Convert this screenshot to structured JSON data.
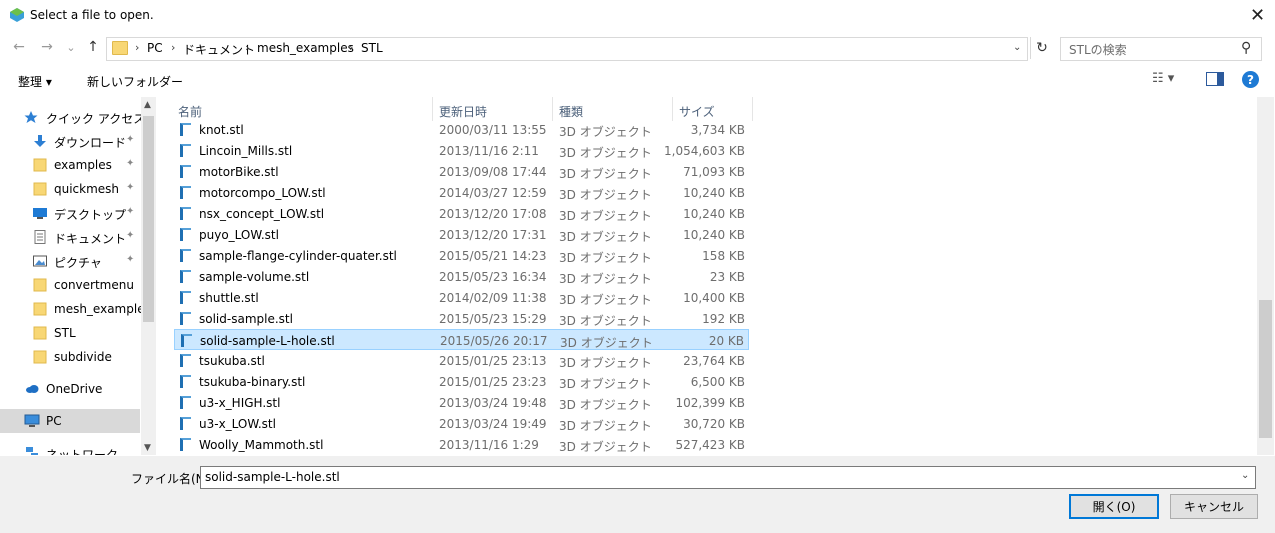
{
  "window": {
    "title": "Select a file to open.",
    "close": "✕"
  },
  "nav": {
    "back": "←",
    "forward": "→",
    "recent": "⌄",
    "up": "↑",
    "breadcrumbs": [
      "PC",
      "ドキュメント",
      "mesh_examples",
      "STL"
    ],
    "crumb_sep": "›",
    "search_placeholder": "STLの検索"
  },
  "toolbar": {
    "organize": "整理 ▾",
    "new_folder": "新しいフォルダー",
    "help": "?"
  },
  "sidebar": {
    "items": [
      {
        "label": "クイック アクセス",
        "icon": "star-icon",
        "pinned": false
      },
      {
        "label": "ダウンロード",
        "icon": "download-icon",
        "pinned": true
      },
      {
        "label": "examples",
        "icon": "folder-icon",
        "pinned": true
      },
      {
        "label": "quickmesh",
        "icon": "folder-icon",
        "pinned": true
      },
      {
        "label": "デスクトップ",
        "icon": "desktop-icon",
        "pinned": true
      },
      {
        "label": "ドキュメント",
        "icon": "document-icon",
        "pinned": true
      },
      {
        "label": "ピクチャ",
        "icon": "pictures-icon",
        "pinned": true
      },
      {
        "label": "convertmenu",
        "icon": "folder-icon",
        "pinned": false
      },
      {
        "label": "mesh_examples",
        "icon": "folder-icon",
        "pinned": false
      },
      {
        "label": "STL",
        "icon": "folder-icon",
        "pinned": false
      },
      {
        "label": "subdivide",
        "icon": "folder-icon",
        "pinned": false
      },
      {
        "label": "OneDrive",
        "icon": "cloud-icon",
        "pinned": false
      },
      {
        "label": "PC",
        "icon": "computer-icon",
        "pinned": false
      },
      {
        "label": "ネットワーク",
        "icon": "network-icon",
        "pinned": false
      }
    ]
  },
  "columns": {
    "name": "名前",
    "date": "更新日時",
    "type": "種類",
    "size": "サイズ"
  },
  "files": [
    {
      "name": "knot.stl",
      "date": "2000/03/11 13:55",
      "type": "3D オブジェクト",
      "size": "3,734 KB"
    },
    {
      "name": "Lincoin_Mills.stl",
      "date": "2013/11/16 2:11",
      "type": "3D オブジェクト",
      "size": "1,054,603 KB"
    },
    {
      "name": "motorBike.stl",
      "date": "2013/09/08 17:44",
      "type": "3D オブジェクト",
      "size": "71,093 KB"
    },
    {
      "name": "motorcompo_LOW.stl",
      "date": "2014/03/27 12:59",
      "type": "3D オブジェクト",
      "size": "10,240 KB"
    },
    {
      "name": "nsx_concept_LOW.stl",
      "date": "2013/12/20 17:08",
      "type": "3D オブジェクト",
      "size": "10,240 KB"
    },
    {
      "name": "puyo_LOW.stl",
      "date": "2013/12/20 17:31",
      "type": "3D オブジェクト",
      "size": "10,240 KB"
    },
    {
      "name": "sample-flange-cylinder-quater.stl",
      "date": "2015/05/21 14:23",
      "type": "3D オブジェクト",
      "size": "158 KB"
    },
    {
      "name": "sample-volume.stl",
      "date": "2015/05/23 16:34",
      "type": "3D オブジェクト",
      "size": "23 KB"
    },
    {
      "name": "shuttle.stl",
      "date": "2014/02/09 11:38",
      "type": "3D オブジェクト",
      "size": "10,400 KB"
    },
    {
      "name": "solid-sample.stl",
      "date": "2015/05/23 15:29",
      "type": "3D オブジェクト",
      "size": "192 KB"
    },
    {
      "name": "solid-sample-L-hole.stl",
      "date": "2015/05/26 20:17",
      "type": "3D オブジェクト",
      "size": "20 KB"
    },
    {
      "name": "tsukuba.stl",
      "date": "2015/01/25 23:13",
      "type": "3D オブジェクト",
      "size": "23,764 KB"
    },
    {
      "name": "tsukuba-binary.stl",
      "date": "2015/01/25 23:23",
      "type": "3D オブジェクト",
      "size": "6,500 KB"
    },
    {
      "name": "u3-x_HIGH.stl",
      "date": "2013/03/24 19:48",
      "type": "3D オブジェクト",
      "size": "102,399 KB"
    },
    {
      "name": "u3-x_LOW.stl",
      "date": "2013/03/24 19:49",
      "type": "3D オブジェクト",
      "size": "30,720 KB"
    },
    {
      "name": "Woolly_Mammoth.stl",
      "date": "2013/11/16 1:29",
      "type": "3D オブジェクト",
      "size": "527,423 KB"
    }
  ],
  "selected_file_index": 10,
  "footer": {
    "filename_label": "ファイル名(N):",
    "filename_value": "solid-sample-L-hole.stl",
    "open_button": "開く(O)",
    "cancel_button": "キャンセル"
  },
  "colors": {
    "selection": "#cce8ff",
    "accent": "#0078d7",
    "folder": "#f8d775"
  }
}
